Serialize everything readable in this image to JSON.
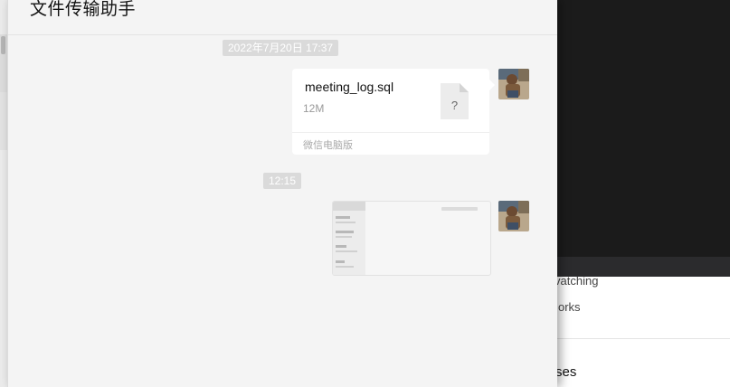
{
  "chat": {
    "title": "文件传输助手",
    "messages": [
      {
        "timestamp": "2022年7月20日 17:37",
        "type": "file",
        "file_name": "meeting_log.sql",
        "file_size": "12M",
        "file_icon_glyph": "?",
        "source": "微信电脑版"
      },
      {
        "timestamp": "12:15",
        "type": "image"
      }
    ]
  },
  "background_window": {
    "items": [
      "vatching",
      "orks"
    ],
    "heading": "ses"
  }
}
